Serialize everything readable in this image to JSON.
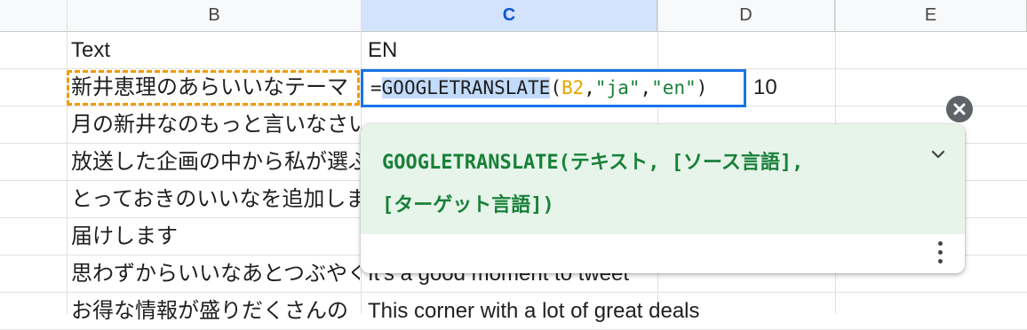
{
  "columns": [
    "B",
    "C",
    "D",
    "E"
  ],
  "rows": [
    {
      "b": "Text",
      "c": "EN"
    },
    {
      "b": "新井恵理のあらいいなテーマ",
      "c": ""
    },
    {
      "b": "月の新井なのもっと言いなさい",
      "c": ""
    },
    {
      "b": "放送した企画の中から私が選ぶ",
      "c": ""
    },
    {
      "b": "とっておきのいいなを追加します",
      "c": ""
    },
    {
      "b": "届けします",
      "c": ""
    },
    {
      "b": "思わずからいいなあとつぶやく",
      "c": "It's a good moment to tweet"
    },
    {
      "b": "お得な情報が盛りだくさんの",
      "c": "This corner with a lot of great deals"
    }
  ],
  "formula": {
    "equals": "=",
    "function": "GOOGLETRANSLATE",
    "open": "(",
    "arg1": "B2",
    "sep1": ",",
    "arg2": "\"ja\"",
    "sep2": ",",
    "arg3": "\"en\"",
    "close": ")"
  },
  "d2_value": "10",
  "tooltip": {
    "signature_line1": "GOOGLETRANSLATE(テキスト, [ソース言語],",
    "signature_line2": "[ターゲット言語])",
    "expand_icon": "chevron-down-icon",
    "more_icon": "more-vert-icon",
    "close_icon": "close-icon"
  },
  "colors": {
    "selection_blue": "#1a73e8",
    "reference_orange": "#f29900",
    "hint_green": "#188038",
    "hint_bg": "#e6f4ea"
  }
}
